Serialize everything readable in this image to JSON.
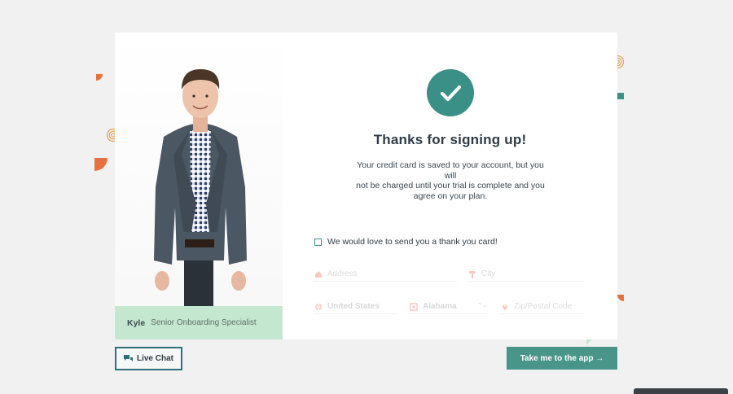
{
  "person": {
    "name": "Kyle",
    "role": "Senior Onboarding Specialist"
  },
  "confirmation": {
    "title": "Thanks for signing up!",
    "line1": "Your credit card is saved to your account, but you will",
    "line2": "not be charged until your trial is complete and you",
    "line3": "agree on your plan."
  },
  "thank_you_card": {
    "label": "We would love to send you a thank you card!",
    "checked": false
  },
  "address_form": {
    "address_placeholder": "Address",
    "city_placeholder": "City",
    "country_value": "United States",
    "state_value": "Alabama",
    "zip_placeholder": "Zip/Postal Code"
  },
  "buttons": {
    "live_chat": "Live Chat",
    "next": "Take me to the app →"
  },
  "colors": {
    "accent": "#3a8f86",
    "button": "#4a9589",
    "name_bar": "#c4e7cf",
    "confetti_orange": "#e8703f"
  }
}
